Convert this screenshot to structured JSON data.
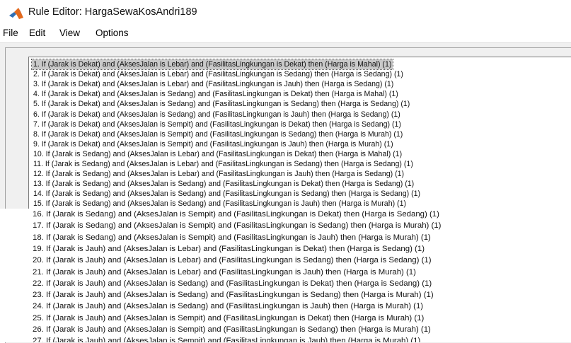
{
  "window": {
    "title": "Rule Editor: HargaSewaKosAndri189"
  },
  "menu": [
    "File",
    "Edit",
    "View",
    "Options"
  ],
  "rules": [
    "1. If (Jarak is Dekat) and (AksesJalan is Lebar) and (FasilitasLingkungan is Dekat) then (Harga is Mahal) (1)",
    "2. If (Jarak is Dekat) and (AksesJalan is Lebar) and (FasilitasLingkungan is Sedang) then (Harga is Sedang) (1)",
    "3. If (Jarak is Dekat) and (AksesJalan is Lebar) and (FasilitasLingkungan is Jauh) then (Harga is Sedang) (1)",
    "4. If (Jarak is Dekat) and (AksesJalan is Sedang) and (FasilitasLingkungan is Dekat) then (Harga is Mahal) (1)",
    "5. If (Jarak is Dekat) and (AksesJalan is Sedang) and (FasilitasLingkungan is Sedang) then (Harga is Sedang) (1)",
    "6. If (Jarak is Dekat) and (AksesJalan is Sedang) and (FasilitasLingkungan is Jauh) then (Harga is Sedang) (1)",
    "7. If (Jarak is Dekat) and (AksesJalan is Sempit) and (FasilitasLingkungan is Dekat) then (Harga is Sedang) (1)",
    "8. If (Jarak is Dekat) and (AksesJalan is Sempit) and (FasilitasLingkungan is Sedang) then (Harga is Murah) (1)",
    "9. If (Jarak is Dekat) and (AksesJalan is Sempit) and (FasilitasLingkungan is Jauh) then (Harga is Murah) (1)",
    "10. If (Jarak is Sedang) and (AksesJalan is Lebar) and (FasilitasLingkungan is Dekat) then (Harga is Mahal) (1)",
    "11. If (Jarak is Sedang) and (AksesJalan is Lebar) and (FasilitasLingkungan is Sedang) then (Harga is Sedang) (1)",
    "12. If (Jarak is Sedang) and (AksesJalan is Lebar) and (FasilitasLingkungan is Jauh) then (Harga is Sedang) (1)",
    "13. If (Jarak is Sedang) and (AksesJalan is Sedang) and (FasilitasLingkungan is Dekat) then (Harga is Sedang) (1)",
    "14. If (Jarak is Sedang) and (AksesJalan is Sedang) and (FasilitasLingkungan is Sedang) then (Harga is Sedang) (1)",
    "15. If (Jarak is Sedang) and (AksesJalan is Sedang) and (FasilitasLingkungan is Jauh) then (Harga is Murah) (1)",
    "16. If (Jarak is Sedang) and (AksesJalan is Sempit) and (FasilitasLingkungan is Dekat) then (Harga is Sedang) (1)",
    "17. If (Jarak is Sedang) and (AksesJalan is Sempit) and (FasilitasLingkungan is Sedang) then (Harga is Murah) (1)",
    "18. If (Jarak is Sedang) and (AksesJalan is Sempit) and (FasilitasLingkungan is Jauh) then (Harga is Murah) (1)",
    "19. If (Jarak is Jauh) and (AksesJalan is Lebar) and (FasilitasLingkungan is Dekat) then (Harga is Sedang) (1)",
    "20. If (Jarak is Jauh) and (AksesJalan is Lebar) and (FasilitasLingkungan is Sedang) then (Harga is Sedang) (1)",
    "21. If (Jarak is Jauh) and (AksesJalan is Lebar) and (FasilitasLingkungan is Jauh) then (Harga is Murah) (1)",
    "22. If (Jarak is Jauh) and (AksesJalan is Sedang) and (FasilitasLingkungan is Dekat) then (Harga is Sedang) (1)",
    "23. If (Jarak is Jauh) and (AksesJalan is Sedang) and (FasilitasLingkungan is Sedang) then (Harga is Murah) (1)",
    "24. If (Jarak is Jauh) and (AksesJalan is Sedang) and (FasilitasLingkungan is Jauh) then (Harga is Murah) (1)",
    "25. If (Jarak is Jauh) and (AksesJalan is Sempit) and (FasilitasLingkungan is Dekat) then (Harga is Murah) (1)",
    "26. If (Jarak is Jauh) and (AksesJalan is Sempit) and (FasilitasLingkungan is Sedang) then (Harga is Murah) (1)",
    "27. If (Jarak is Jauh) and (AksesJalan is Sempit) and (FasilitasLingkungan is Jauh) then (Harga is Murah) (1)"
  ],
  "selected_rule_index": 0
}
